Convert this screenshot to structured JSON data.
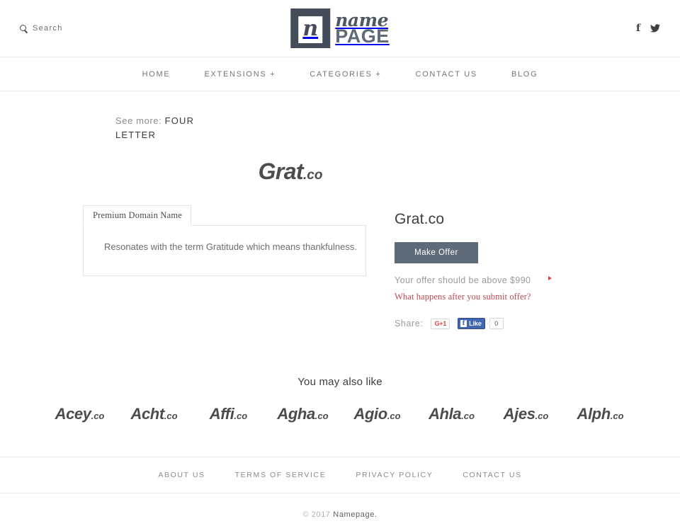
{
  "topbar": {
    "search_label": "Search",
    "search_icon": "search-icon",
    "logo": {
      "mark_letter": "n",
      "name_part": "name",
      "page_part": "PAGE"
    },
    "social": [
      {
        "name": "facebook-icon",
        "glyph": "f"
      },
      {
        "name": "twitter-icon",
        "glyph": "twitter-bird"
      }
    ]
  },
  "nav": {
    "items": [
      {
        "label": "HOME"
      },
      {
        "label": "EXTENSIONS +"
      },
      {
        "label": "CATEGORIES +"
      },
      {
        "label": "CONTACT US"
      },
      {
        "label": "BLOG"
      }
    ]
  },
  "breadcrumb": {
    "prefix": "See more:",
    "link": "FOUR LETTER"
  },
  "hero": {
    "domain_name": "Grat",
    "domain_tld": ".co"
  },
  "details": {
    "tab_label": "Premium Domain Name",
    "description": "Resonates with the term Gratitude which means thankfulness."
  },
  "offer": {
    "domain_title": "Grat.co",
    "make_offer_label": "Make Offer",
    "hint": "Your offer should be above $990",
    "minimum_price": "$990",
    "what_happens_link": "What happens after you submit offer?",
    "share_label": "Share:",
    "gplus_label": "G+1",
    "fb_like_label": "Like",
    "fb_share_count": "0",
    "button_color": "#5e6b78",
    "accent_red": "#c0474e"
  },
  "also_like": {
    "title": "You may also like",
    "items": [
      {
        "name": "Acey",
        "tld": ".co"
      },
      {
        "name": "Acht",
        "tld": ".co"
      },
      {
        "name": "Affi",
        "tld": ".co"
      },
      {
        "name": "Agha",
        "tld": ".co"
      },
      {
        "name": "Agio",
        "tld": ".co"
      },
      {
        "name": "Ahla",
        "tld": ".co"
      },
      {
        "name": "Ajes",
        "tld": ".co"
      },
      {
        "name": "Alph",
        "tld": ".co"
      }
    ]
  },
  "footer": {
    "links": [
      {
        "label": "ABOUT US"
      },
      {
        "label": "TERMS OF SERVICE"
      },
      {
        "label": "PRIVACY POLICY"
      },
      {
        "label": "CONTACT US"
      }
    ],
    "copyright_year": "© 2017",
    "copyright_name": "Namepage."
  }
}
